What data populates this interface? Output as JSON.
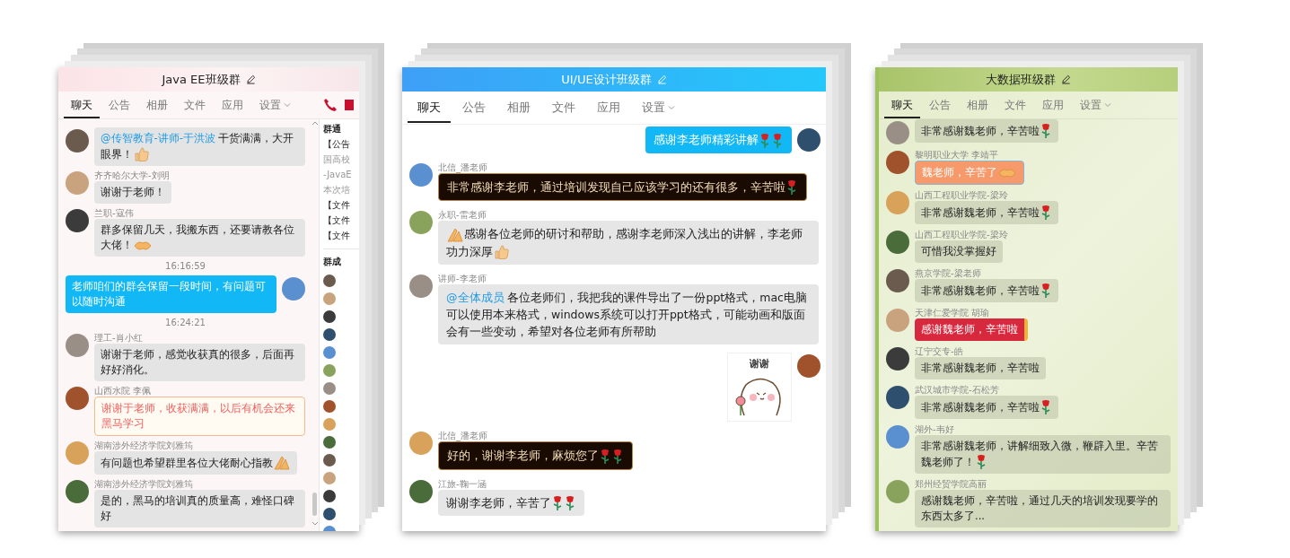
{
  "windows": [
    {
      "kind": "pink",
      "title": "Java EE班级群",
      "tabs": [
        {
          "label": "聊天",
          "selected": true,
          "dropdown": false
        },
        {
          "label": "公告",
          "selected": false,
          "dropdown": false
        },
        {
          "label": "相册",
          "selected": false,
          "dropdown": false
        },
        {
          "label": "文件",
          "selected": false,
          "dropdown": false
        },
        {
          "label": "应用",
          "selected": false,
          "dropdown": false
        },
        {
          "label": "设置",
          "selected": false,
          "dropdown": true
        }
      ],
      "messages": [
        {
          "kind": "plain",
          "parts": [
            {
              "kind": "mention",
              "text": "@传智教育-讲师-于洪波"
            },
            {
              "kind": "text",
              "text": " 干货满满，大开眼界！"
            },
            {
              "kind": "thumb"
            }
          ]
        },
        {
          "kind": "plain",
          "sender": "齐齐哈尔大学-刘明",
          "parts": [
            {
              "kind": "text",
              "text": "谢谢于老师！"
            }
          ]
        },
        {
          "kind": "plain",
          "sender": "兰职-寇伟",
          "parts": [
            {
              "kind": "text",
              "text": "群多保留几天，我搬东西，还要请教各位大佬！"
            },
            {
              "kind": "handshake"
            }
          ]
        },
        {
          "kind": "time",
          "text": "16:16:59"
        },
        {
          "kind": "self",
          "parts": [
            {
              "kind": "text",
              "text": "老师咱们的群会保留一段时间，有问题可以随时沟通"
            }
          ]
        },
        {
          "kind": "time",
          "text": "16:24:21"
        },
        {
          "kind": "plain",
          "sender": "理工-肖小红",
          "parts": [
            {
              "kind": "text",
              "text": "谢谢于老师，感觉收获真的很多，后面再好好消化。"
            }
          ]
        },
        {
          "kind": "peach",
          "sender": "山西水院 李佩",
          "parts": [
            {
              "kind": "text",
              "text": "谢谢于老师，收获满满，以后有机会还来黑马学习"
            }
          ]
        },
        {
          "kind": "plain",
          "sender": "湖南涉外经济学院刘雅筠",
          "parts": [
            {
              "kind": "text",
              "text": "有问题也希望群里各位大佬耐心指教"
            },
            {
              "kind": "palms"
            }
          ]
        },
        {
          "kind": "plain",
          "sender": "湖南涉外经济学院刘雅筠",
          "parts": [
            {
              "kind": "text",
              "text": "是的，黑马的培训真的质量高，难怪口碑好"
            }
          ]
        }
      ],
      "side_panel": {
        "lines": [
          {
            "kind": "heading",
            "text": "群通"
          },
          {
            "kind": "text",
            "text": "【公告"
          },
          {
            "kind": "muted",
            "text": "国高校"
          },
          {
            "kind": "muted",
            "text": "-JavaE"
          },
          {
            "kind": "muted",
            "text": "本次培"
          },
          {
            "kind": "text",
            "text": "【文件"
          },
          {
            "kind": "text",
            "text": "【文件"
          },
          {
            "kind": "text",
            "text": "【文件"
          }
        ],
        "members_heading": "群成"
      }
    },
    {
      "kind": "blue",
      "title": "UI/UE设计班级群",
      "tabs": [
        {
          "label": "聊天",
          "selected": true,
          "dropdown": false
        },
        {
          "label": "公告",
          "selected": false,
          "dropdown": false
        },
        {
          "label": "相册",
          "selected": false,
          "dropdown": false
        },
        {
          "label": "文件",
          "selected": false,
          "dropdown": false
        },
        {
          "label": "应用",
          "selected": false,
          "dropdown": false
        },
        {
          "label": "设置",
          "selected": false,
          "dropdown": true
        }
      ],
      "messages": [
        {
          "kind": "self",
          "parts": [
            {
              "kind": "text",
              "text": "感谢李老师精彩讲解"
            },
            {
              "kind": "rose"
            },
            {
              "kind": "rose"
            }
          ]
        },
        {
          "kind": "dark",
          "sender": "北信_潘老师",
          "parts": [
            {
              "kind": "text",
              "text": "非常感谢李老师，通过培训发现自己应该学习的还有很多，辛苦啦"
            },
            {
              "kind": "rose"
            }
          ]
        },
        {
          "kind": "plain",
          "sender": "永职-雷老师",
          "parts": [
            {
              "kind": "palms"
            },
            {
              "kind": "text",
              "text": "感谢各位老师的研讨和帮助，感谢李老师深入浅出的讲解，李老师功力深厚"
            },
            {
              "kind": "thumb"
            }
          ]
        },
        {
          "kind": "plain",
          "sender": "讲师-李老师",
          "parts": [
            {
              "kind": "mention",
              "text": "@全体成员"
            },
            {
              "kind": "text",
              "text": " 各位老师们，我把我的课件导出了一份ppt格式，mac电脑可以使用本来格式，windows系统可以打开ppt格式，可能动画和版面会有一些变动，希望对各位老师有所帮助"
            }
          ]
        },
        {
          "kind": "sticker",
          "caption": "谢谢"
        },
        {
          "kind": "dark",
          "sender": "北信_潘老师",
          "parts": [
            {
              "kind": "text",
              "text": "好的，谢谢李老师，麻烦您了"
            },
            {
              "kind": "rose"
            },
            {
              "kind": "rose"
            }
          ]
        },
        {
          "kind": "plain",
          "sender": "江旅-鞠一涵",
          "parts": [
            {
              "kind": "text",
              "text": "谢谢李老师，辛苦了"
            },
            {
              "kind": "rose"
            },
            {
              "kind": "rose"
            }
          ]
        }
      ]
    },
    {
      "kind": "green",
      "title": "大数据班级群",
      "tabs": [
        {
          "label": "聊天",
          "selected": true,
          "dropdown": false
        },
        {
          "label": "公告",
          "selected": false,
          "dropdown": false
        },
        {
          "label": "相册",
          "selected": false,
          "dropdown": false
        },
        {
          "label": "文件",
          "selected": false,
          "dropdown": false
        },
        {
          "label": "应用",
          "selected": false,
          "dropdown": false
        },
        {
          "label": "设置",
          "selected": false,
          "dropdown": true
        }
      ],
      "messages": [
        {
          "kind": "plain",
          "parts": [
            {
              "kind": "text",
              "text": "非常感谢魏老师，辛苦啦"
            },
            {
              "kind": "rose"
            }
          ]
        },
        {
          "kind": "orange",
          "sender": "黎明职业大学 李靖平",
          "parts": [
            {
              "kind": "text",
              "text": "魏老师，辛苦了"
            },
            {
              "kind": "handshake"
            }
          ]
        },
        {
          "kind": "plain",
          "sender": "山西工程职业学院-梁玲",
          "parts": [
            {
              "kind": "text",
              "text": "非常感谢魏老师，辛苦啦"
            },
            {
              "kind": "rose"
            }
          ]
        },
        {
          "kind": "plain",
          "sender": "山西工程职业学院-梁玲",
          "parts": [
            {
              "kind": "text",
              "text": "可惜我没掌握好"
            }
          ]
        },
        {
          "kind": "plain",
          "sender": "燕京学院-梁老师",
          "parts": [
            {
              "kind": "text",
              "text": "非常感谢魏老师，辛苦啦"
            },
            {
              "kind": "rose"
            }
          ]
        },
        {
          "kind": "red",
          "sender": "天津仁爱学院 胡瑜",
          "parts": [
            {
              "kind": "text",
              "text": "感谢魏老师，辛苦啦"
            }
          ]
        },
        {
          "kind": "plain",
          "sender": "辽宁交专-皓",
          "parts": [
            {
              "kind": "text",
              "text": "非常感谢魏老师，辛苦啦"
            }
          ]
        },
        {
          "kind": "plain",
          "sender": "武汉城市学院-石松芳",
          "parts": [
            {
              "kind": "text",
              "text": "非常感谢魏老师，辛苦啦"
            },
            {
              "kind": "rose"
            }
          ]
        },
        {
          "kind": "plain",
          "sender": "湖外-韦好",
          "parts": [
            {
              "kind": "text",
              "text": "非常感谢魏老师，讲解细致入微，鞭辟入里。辛苦魏老师了！"
            },
            {
              "kind": "rose"
            }
          ]
        },
        {
          "kind": "plain",
          "sender": "郑州经贸学院高丽",
          "parts": [
            {
              "kind": "text",
              "text": "感谢魏老师，辛苦啦，通过几天的培训发现要学的东西太多了..."
            }
          ]
        }
      ]
    }
  ]
}
